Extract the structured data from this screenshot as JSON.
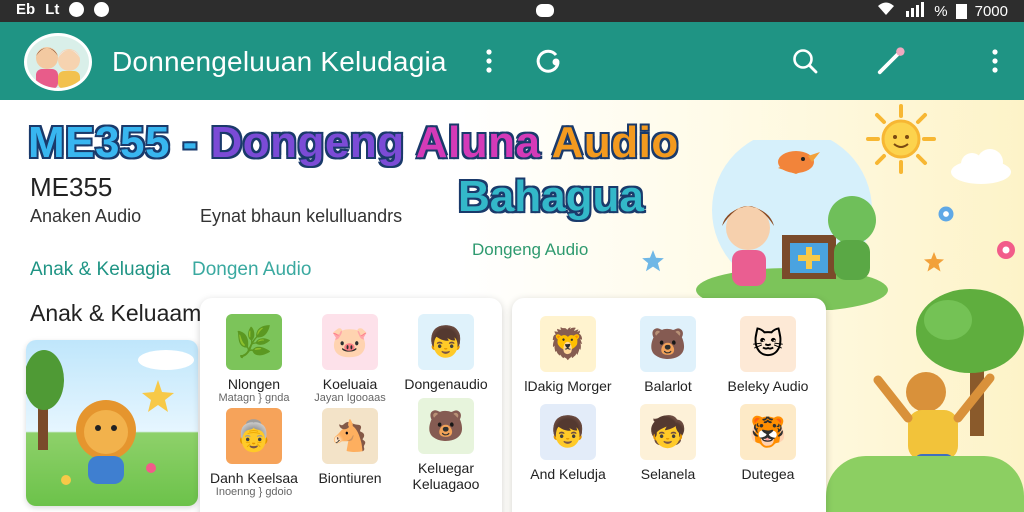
{
  "status_bar": {
    "left_icons": [
      "Eb",
      "Lt"
    ],
    "signal_text": "%",
    "time": "7000"
  },
  "app_bar": {
    "title": "Donnengeluuan Keludagia",
    "icons": [
      "more-vert-icon",
      "refresh-icon",
      "search-icon",
      "edit-icon",
      "more-vert-icon"
    ]
  },
  "hero": {
    "brand_parts": [
      "ME355",
      " - ",
      "Dongeng",
      " Aluna",
      " Audio"
    ],
    "brand_line2": "Bahagua",
    "code": "ME355",
    "subtitle_left": "Anaken Audio",
    "subtitle_right": "Eynat bhaun kelulluandrs",
    "accent": "Dongeng Audio",
    "tag_primary": "Anak & Keluagia",
    "tag_secondary": "Dongen Audio",
    "section_title": "Anak & Keluaam"
  },
  "panel1": {
    "items": [
      {
        "label": "Nlongen",
        "sub": "Matagn } gnda",
        "icon": "🌿"
      },
      {
        "label": "Koeluaia",
        "sub": "Jayan Igooaas",
        "icon": "🐷"
      },
      {
        "label": "Dongenaudio",
        "sub": "",
        "icon": "👦"
      },
      {
        "label": "Danh Keelsaa",
        "sub": "Inoenng } gdoio",
        "icon": "👵"
      },
      {
        "label": "Biontiuren",
        "sub": "",
        "icon": "🐴"
      },
      {
        "label": "Keluegar",
        "sub": "Keluagaoo",
        "icon": "🐻"
      }
    ]
  },
  "panel2": {
    "items": [
      {
        "label": "lDakig Morger",
        "icon": "🦁"
      },
      {
        "label": "Balarlot",
        "icon": "🐻"
      },
      {
        "label": "Beleky Audio",
        "icon": "🐱"
      },
      {
        "label": "And Keludja",
        "icon": "👦"
      },
      {
        "label": "Selanela",
        "icon": "🧒"
      },
      {
        "label": "Dutegea",
        "icon": "🐯"
      }
    ]
  },
  "colors": {
    "app_bar": "#1f9484",
    "accent_teal": "#1f9484",
    "brand_blue": "#38b6f0",
    "brand_purple": "#7b4bd6",
    "brand_pink": "#d43ab8",
    "brand_orange": "#f39a1f"
  }
}
